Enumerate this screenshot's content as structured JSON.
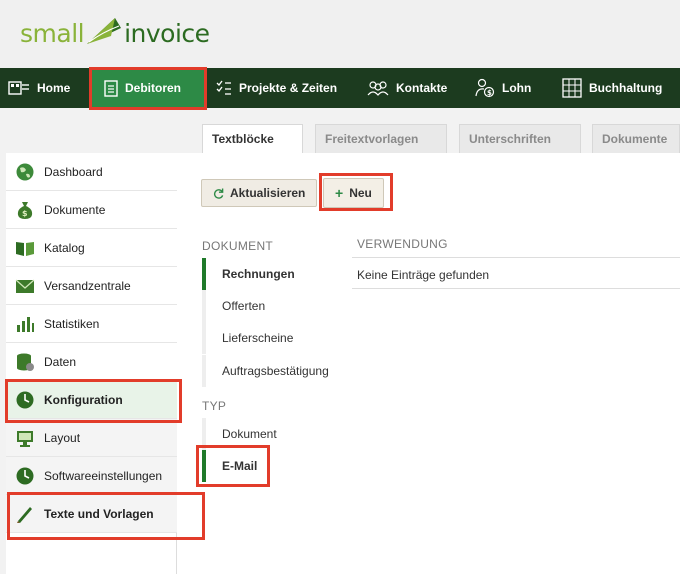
{
  "logo": {
    "word1": "small",
    "word2": "invoice"
  },
  "topnav": [
    {
      "label": "Home",
      "icon": "home-icon"
    },
    {
      "label": "Debitoren",
      "icon": "document-icon",
      "active": true
    },
    {
      "label": "Projekte & Zeiten",
      "icon": "checklist-icon"
    },
    {
      "label": "Kontakte",
      "icon": "contacts-icon"
    },
    {
      "label": "Lohn",
      "icon": "salary-icon"
    },
    {
      "label": "Buchhaltung",
      "icon": "ledger-icon"
    }
  ],
  "tabs": [
    "Textblöcke",
    "Freitextvorlagen",
    "Unterschriften",
    "Dokumente"
  ],
  "sidebar": [
    {
      "label": "Dashboard",
      "icon": "globe-icon"
    },
    {
      "label": "Dokumente",
      "icon": "money-bag-icon"
    },
    {
      "label": "Katalog",
      "icon": "book-icon"
    },
    {
      "label": "Versandzentrale",
      "icon": "envelope-icon"
    },
    {
      "label": "Statistiken",
      "icon": "bar-chart-icon"
    },
    {
      "label": "Daten",
      "icon": "database-icon"
    },
    {
      "label": "Konfiguration",
      "icon": "clock-icon"
    },
    {
      "label": "Layout",
      "icon": "monitor-icon"
    },
    {
      "label": "Softwareeinstellungen",
      "icon": "clock-icon"
    },
    {
      "label": "Texte und Vorlagen",
      "icon": "pen-icon"
    }
  ],
  "toolbar": {
    "refresh_label": "Aktualisieren",
    "new_label": "Neu"
  },
  "filters": {
    "dokument_heading": "DOKUMENT",
    "dokument_items": [
      "Rechnungen",
      "Offerten",
      "Lieferscheine",
      "Auftragsbestätigung"
    ],
    "typ_heading": "TYP",
    "typ_items": [
      "Dokument",
      "E-Mail"
    ]
  },
  "table": {
    "header": "VERWENDUNG",
    "empty_text": "Keine Einträge gefunden"
  },
  "colors": {
    "nav_bg": "#1c3b1f",
    "nav_active": "#2d8a46",
    "accent_green": "#1f7a2a",
    "highlight_red": "#e23c2a"
  }
}
